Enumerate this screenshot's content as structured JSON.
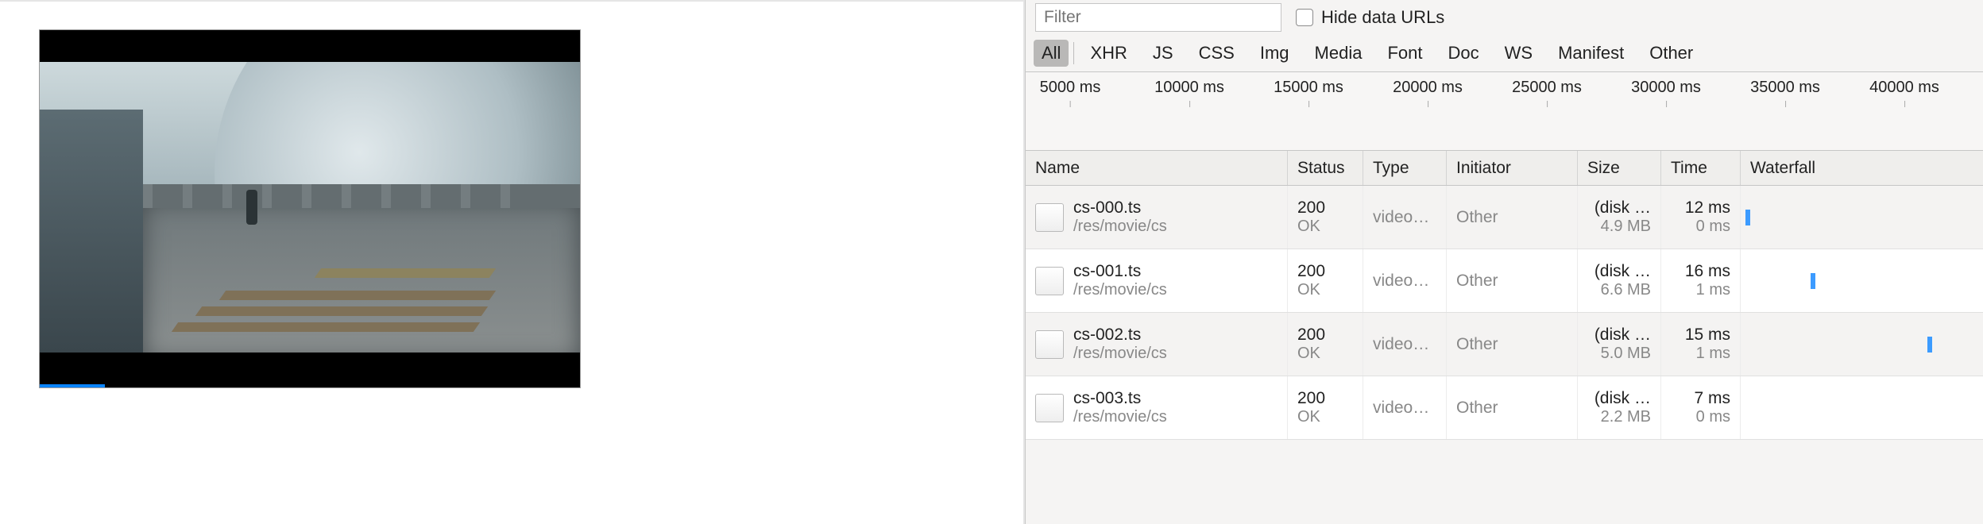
{
  "filter": {
    "placeholder": "Filter"
  },
  "hide_data_urls": {
    "label": "Hide data URLs",
    "checked": false
  },
  "type_filters": {
    "selected": "All",
    "items": [
      "All",
      "XHR",
      "JS",
      "CSS",
      "Img",
      "Media",
      "Font",
      "Doc",
      "WS",
      "Manifest",
      "Other"
    ]
  },
  "timeline_ticks": [
    "5000 ms",
    "10000 ms",
    "15000 ms",
    "20000 ms",
    "25000 ms",
    "30000 ms",
    "35000 ms",
    "40000 ms"
  ],
  "columns": {
    "name": "Name",
    "status": "Status",
    "type": "Type",
    "initiator": "Initiator",
    "size": "Size",
    "time": "Time",
    "waterfall": "Waterfall"
  },
  "rows": [
    {
      "name": "cs-000.ts",
      "path": "/res/movie/cs",
      "status": "200",
      "status_sub": "OK",
      "type": "video…",
      "initiator": "Other",
      "size_top": "(disk …",
      "size_sub": "4.9 MB",
      "time_top": "12 ms",
      "time_sub": "0 ms",
      "wf_left_pct": 2
    },
    {
      "name": "cs-001.ts",
      "path": "/res/movie/cs",
      "status": "200",
      "status_sub": "OK",
      "type": "video…",
      "initiator": "Other",
      "size_top": "(disk …",
      "size_sub": "6.6 MB",
      "time_top": "16 ms",
      "time_sub": "1 ms",
      "wf_left_pct": 29
    },
    {
      "name": "cs-002.ts",
      "path": "/res/movie/cs",
      "status": "200",
      "status_sub": "OK",
      "type": "video…",
      "initiator": "Other",
      "size_top": "(disk …",
      "size_sub": "5.0 MB",
      "time_top": "15 ms",
      "time_sub": "1 ms",
      "wf_left_pct": 77
    },
    {
      "name": "cs-003.ts",
      "path": "/res/movie/cs",
      "status": "200",
      "status_sub": "OK",
      "type": "video…",
      "initiator": "Other",
      "size_top": "(disk …",
      "size_sub": "2.2 MB",
      "time_top": "7 ms",
      "time_sub": "0 ms",
      "wf_left_pct": 100
    }
  ]
}
